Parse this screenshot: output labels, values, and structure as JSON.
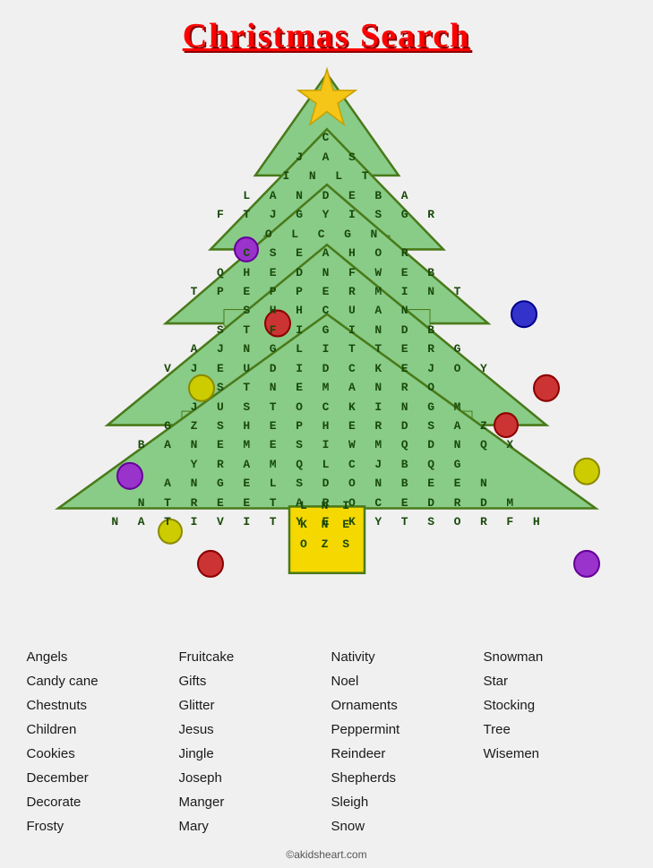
{
  "title": "Christmas Search",
  "grid": {
    "rows": [
      "        C        ",
      "      J A S      ",
      "     I N L T     ",
      "    L A N D E B A    ",
      "   F T J G Y I S G R   ",
      "    O L C G N    ",
      "   C S E A H O R   ",
      "  Q H E D N F W E B  ",
      " T P E P P E R M I N T ",
      "  S H H C U A N  ",
      "  S T F I G I N D B  ",
      " A J N G L I T T E R G ",
      "V J E U D I D C K E J O Y",
      " S T N E M A N R O ",
      "J U S T O C K I N G M",
      "G Z S H E P H E R D S A Z",
      "B A N E M E S I W M Q D N Q X",
      " Y R A M Q L C J B Q G ",
      "A N G E L S D O N B E E N",
      "N T R E E T A R O C E D R D M",
      "N A T I V I T Y E K Y T S O R F H"
    ],
    "trunk": [
      "L N I",
      "K N E",
      "O Z S"
    ]
  },
  "word_list": {
    "col1": [
      "Angels",
      "Candy cane",
      "Chestnuts",
      "Children",
      "Cookies",
      "December",
      "Decorate",
      "Frosty"
    ],
    "col2": [
      "Fruitcake",
      "Gifts",
      "Glitter",
      "Jesus",
      "Jingle",
      "Joseph",
      "Manger",
      "Mary"
    ],
    "col3": [
      "Nativity",
      "Noel",
      "Ornaments",
      "Peppermint",
      "Reindeer",
      "Shepherds",
      "Sleigh",
      "Snow"
    ],
    "col4": [
      "Snowman",
      "Star",
      "Stocking",
      "Tree",
      "Wisemen"
    ]
  },
  "copyright": "©akidsheart.com"
}
